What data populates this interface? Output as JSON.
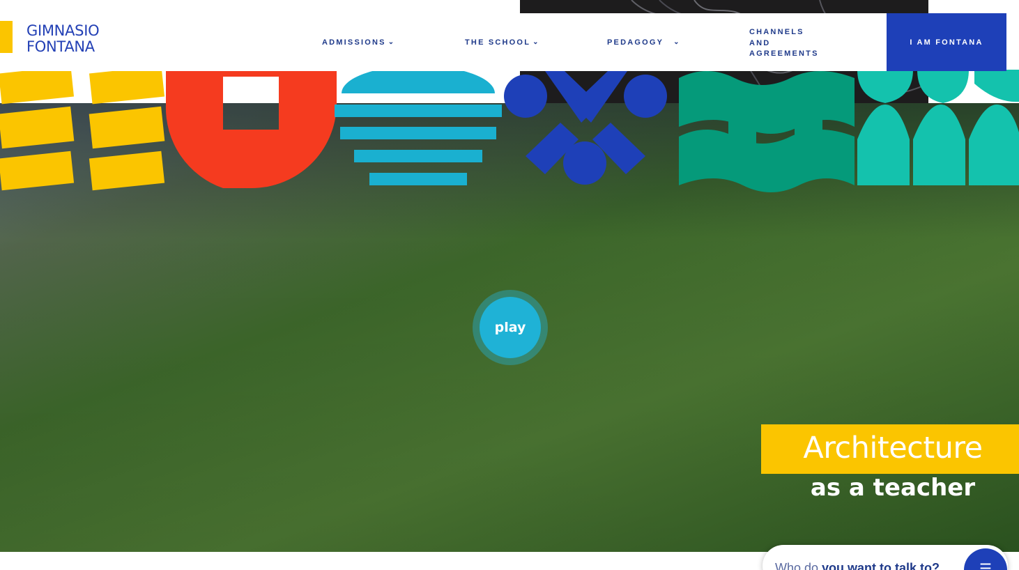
{
  "brand": {
    "line1": "GIMNASIO",
    "line2": "FONTANA",
    "color": "#2340b5"
  },
  "nav": {
    "admissions": "ADMISSIONS",
    "the_school": "THE SCHOOL",
    "pedagogy": "PEDAGOGY",
    "channels": [
      "CHANNELS",
      "AND",
      "AGREEMENTS"
    ],
    "cta": "I AM FONTANA",
    "chevron": "⌄"
  },
  "hero": {
    "play_label": "play",
    "caption_title": "Architecture",
    "caption_sub": "as a teacher",
    "shape_colors": {
      "yellow": "#fbc500",
      "red": "#f53b1f",
      "cyan": "#1ab0d0",
      "blue": "#1e40b8",
      "green": "#059a7a",
      "teal": "#14c2ad"
    }
  },
  "chat": {
    "prefix": "Who do ",
    "emphasis": "you want to talk to?",
    "icon": "chat-lines-icon"
  }
}
